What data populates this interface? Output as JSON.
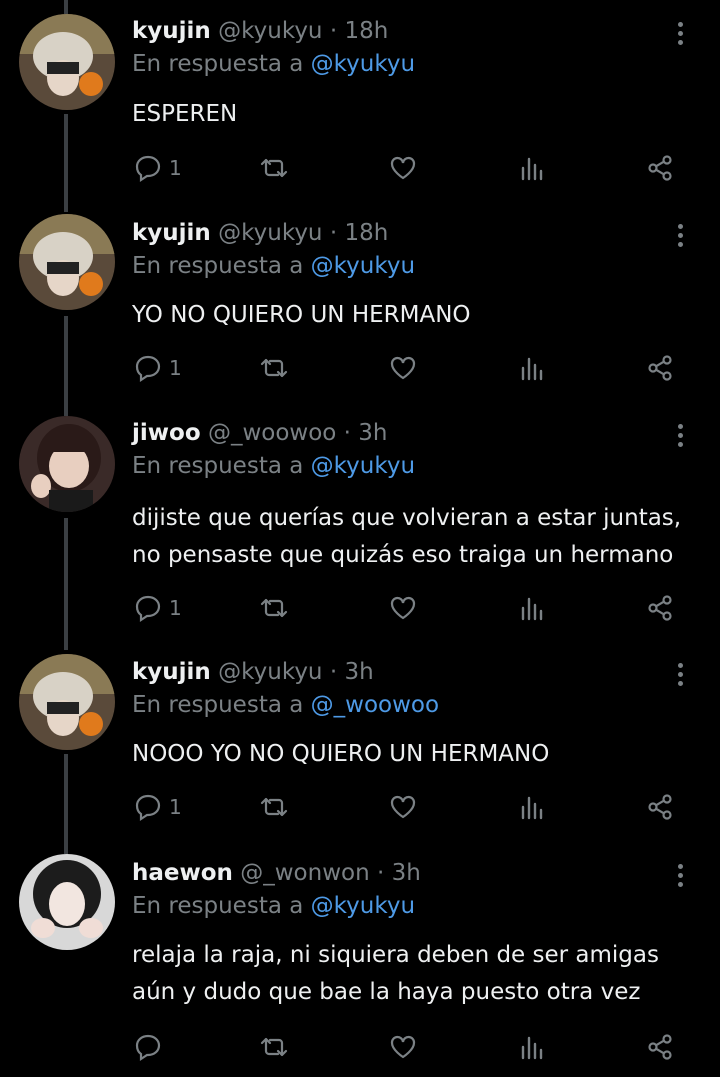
{
  "reply_prefix": "En respuesta a",
  "tweets": [
    {
      "name": "kyujin",
      "handle": "@kyukyu",
      "time": "· 18h",
      "reply_to": "@kyukyu",
      "text": "ESPEREN",
      "replies": "1"
    },
    {
      "name": "kyujin",
      "handle": "@kyukyu",
      "time": "· 18h",
      "reply_to": "@kyukyu",
      "text": "YO NO QUIERO UN HERMANO",
      "replies": "1"
    },
    {
      "name": "jiwoo",
      "handle": "@_woowoo",
      "time": "· 3h",
      "reply_to": "@kyukyu",
      "text_lines": [
        "dijiste que querías que volvieran a estar juntas,",
        "no pensaste que quizás eso traiga un hermano"
      ],
      "replies": "1"
    },
    {
      "name": "kyujin",
      "handle": "@kyukyu",
      "time": "· 3h",
      "reply_to": "@_woowoo",
      "text": "NOOO YO NO QUIERO UN HERMANO",
      "replies": "1"
    },
    {
      "name": "haewon",
      "handle": "@_wonwon",
      "time": "· 3h",
      "reply_to": "@kyukyu",
      "text_lines": [
        "relaja la raja, ni siquiera deben de ser amigas",
        "aún y dudo que bae la haya puesto otra vez"
      ],
      "replies": ""
    }
  ],
  "icons": [
    "reply-icon",
    "retweet-icon",
    "like-icon",
    "views-icon",
    "share-icon",
    "more-icon"
  ],
  "colors": {
    "background": "#000000",
    "text": "#eef0f1",
    "muted": "#7b8185",
    "mention": "#4e9ae6",
    "thread_line": "#3b3f43"
  }
}
